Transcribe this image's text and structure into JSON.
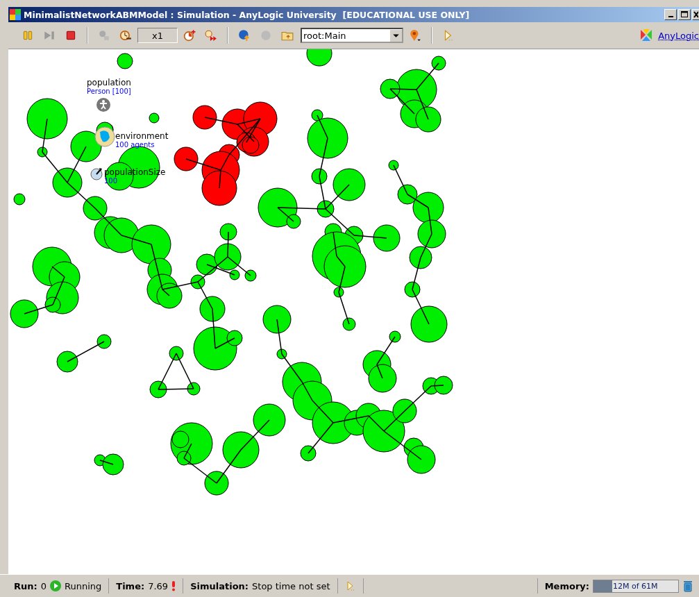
{
  "window": {
    "title": "MinimalistNetworkABMModel : Simulation - AnyLogic University  [EDUCATIONAL USE ONLY]"
  },
  "toolbar": {
    "speed": "x1",
    "view_select": "root:Main",
    "brand_link": "AnyLogic"
  },
  "canvas": {
    "objects": [
      {
        "kind": "population",
        "name": "population",
        "detail": "Person [100]"
      },
      {
        "kind": "environment",
        "name": "environment",
        "detail": "100 agents"
      },
      {
        "kind": "parameter",
        "name": "populationSize",
        "detail": "100"
      }
    ]
  },
  "status_bar": {
    "run_label": "Run:",
    "run_value": "0",
    "state": "Running",
    "time_label": "Time:",
    "time_value": "7.69",
    "simulation_label": "Simulation:",
    "simulation_value": "Stop time not set",
    "memory_label": "Memory:",
    "memory": {
      "level": 0.22,
      "reading": "12M of 61M"
    }
  }
}
